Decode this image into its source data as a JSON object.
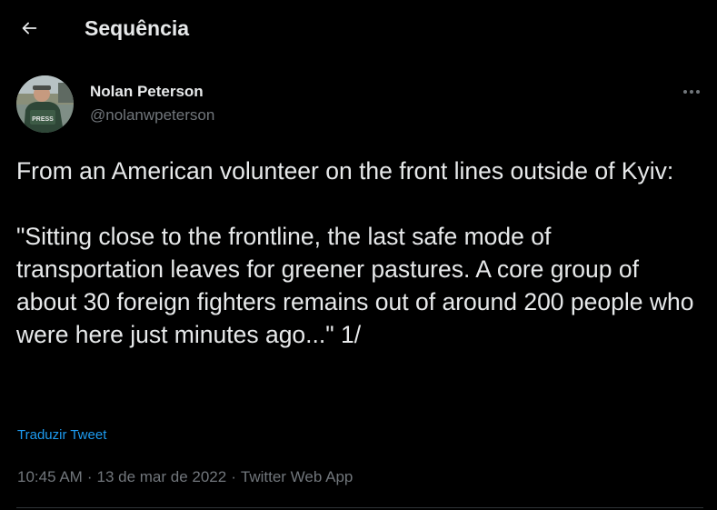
{
  "header": {
    "back_icon": "arrow-left-icon",
    "title": "Sequência"
  },
  "tweet": {
    "author": {
      "name": "Nolan Peterson",
      "handle": "@nolanwpeterson",
      "avatar_badge": "PRESS"
    },
    "more_icon": "more-horizontal-icon",
    "text": "From an American volunteer on the front lines outside of Kyiv:\n\n\"Sitting close to the frontline, the last safe mode of transportation leaves for greener pastures. A core group of about 30 foreign fighters remains out of around 200 people who were here just minutes ago...\" 1/",
    "translate_label": "Traduzir Tweet",
    "time": "10:45 AM",
    "date": "13 de mar de 2022",
    "source": "Twitter Web App",
    "separator": "·"
  },
  "colors": {
    "background": "#000000",
    "primary_text": "#e7e9ea",
    "secondary_text": "#71767b",
    "accent": "#1d9bf0",
    "divider": "#2f3336"
  }
}
